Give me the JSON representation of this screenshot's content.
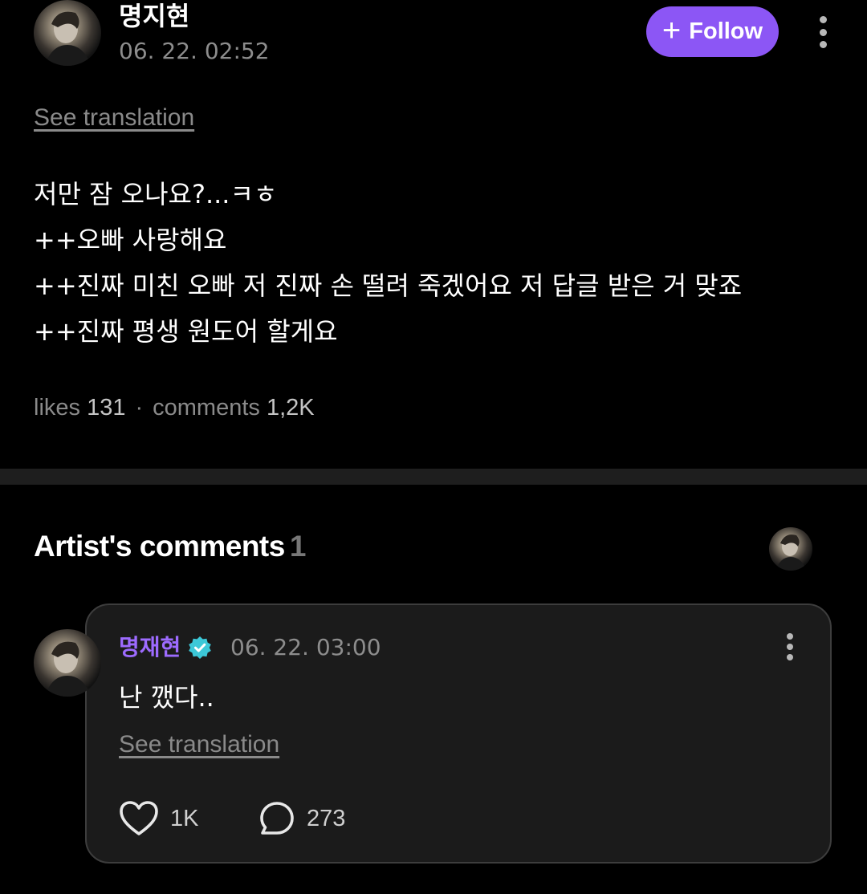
{
  "post": {
    "author": "명지현",
    "timestamp": "06. 22. 02:52",
    "follow_label": "Follow",
    "see_translation": "See translation",
    "body_lines": [
      "저만 잠 오나요?...ㅋㅎ",
      "++오빠 사랑해요",
      "++진짜 미친 오빠 저 진짜 손 떨려 죽겠어요 저 답글 받은 거 맞죠",
      "++진짜 평생 원도어 할게요"
    ],
    "stats": {
      "likes_label": "likes",
      "likes_value": "131",
      "separator": "·",
      "comments_label": "comments",
      "comments_value": "1,2K"
    }
  },
  "artist_comments": {
    "title": "Artist's comments",
    "count": "1"
  },
  "comment": {
    "author": "명재현",
    "verified_icon": "verified-badge-icon",
    "timestamp": "06. 22. 03:00",
    "text": "난 깼다..",
    "see_translation": "See translation",
    "likes": "1K",
    "replies": "273"
  },
  "icons": {
    "follow": "plus-icon",
    "menu": "more-vertical-icon",
    "like": "heart-icon",
    "reply": "speech-bubble-icon"
  },
  "colors": {
    "background": "#000000",
    "accent": "#8c56f5",
    "artist_name": "#9d6bff",
    "verified_badge": "#3cc8d8",
    "card_background": "#1b1b1b"
  }
}
